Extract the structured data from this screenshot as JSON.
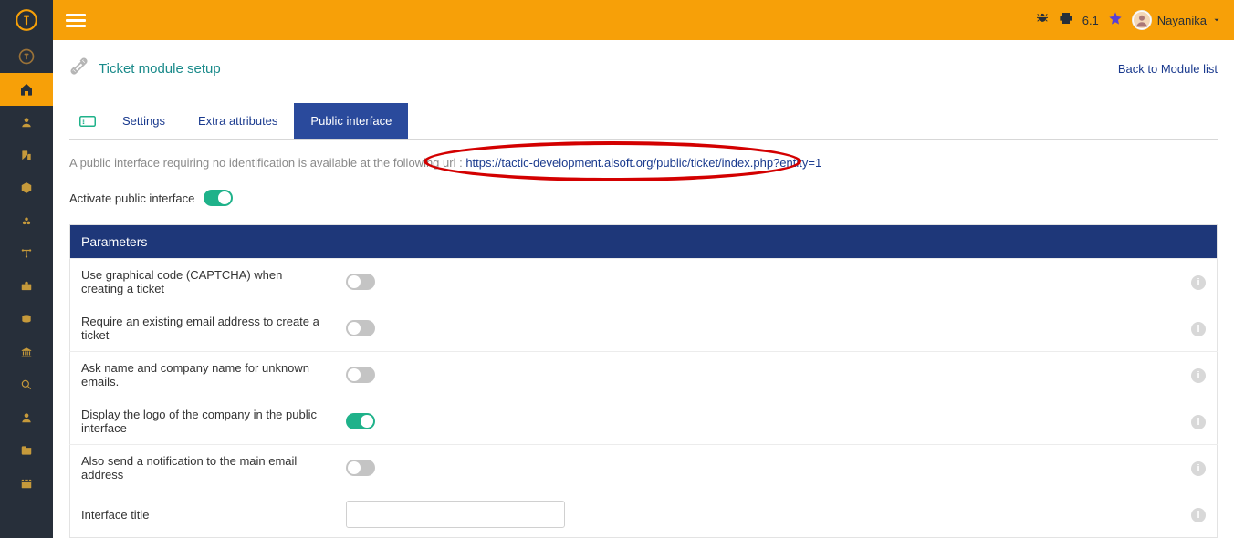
{
  "topbar": {
    "version": "6.1",
    "user_name": "Nayanika"
  },
  "page": {
    "title": "Ticket module setup",
    "back_link": "Back to Module list"
  },
  "tabs": {
    "settings": "Settings",
    "extra_attributes": "Extra attributes",
    "public_interface": "Public interface"
  },
  "intro": {
    "prefix": "A public interface requiring no identification is available at the following url : ",
    "url": "https://tactic-development.alsoft.org/public/ticket/index.php?entity=1"
  },
  "activate": {
    "label": "Activate public interface",
    "on": true
  },
  "params": {
    "header": "Parameters",
    "rows": [
      {
        "label": "Use graphical code (CAPTCHA) when creating a ticket",
        "type": "toggle",
        "on": false
      },
      {
        "label": "Require an existing email address to create a ticket",
        "type": "toggle",
        "on": false
      },
      {
        "label": "Ask name and company name for unknown emails.",
        "type": "toggle",
        "on": false
      },
      {
        "label": "Display the logo of the company in the public interface",
        "type": "toggle",
        "on": true
      },
      {
        "label": "Also send a notification to the main email address",
        "type": "toggle",
        "on": false
      },
      {
        "label": "Interface title",
        "type": "text",
        "value": ""
      }
    ]
  },
  "sidebar_icons": [
    "home-icon",
    "user-icon",
    "company-icon",
    "box-icon",
    "bug2-icon",
    "network-icon",
    "briefcase-icon",
    "coins-icon",
    "bank-icon",
    "search-icon",
    "user2-icon",
    "folder-icon",
    "calendar-icon"
  ]
}
